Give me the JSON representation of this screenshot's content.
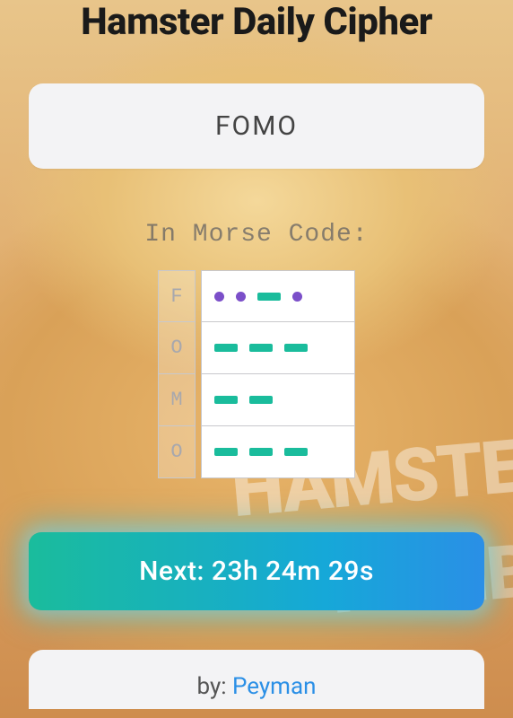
{
  "title": "Hamster Daily Cipher",
  "answer": "FOMO",
  "morse_label": "In Morse Code:",
  "morse_rows": [
    {
      "letter": "F",
      "pattern": [
        ".",
        ".",
        "-",
        "."
      ]
    },
    {
      "letter": "O",
      "pattern": [
        "-",
        "-",
        "-"
      ]
    },
    {
      "letter": "M",
      "pattern": [
        "-",
        "-"
      ]
    },
    {
      "letter": "O",
      "pattern": [
        "-",
        "-",
        "-"
      ]
    }
  ],
  "next_prefix": "Next: ",
  "next_time": "23h 24m 29s",
  "credit_prefix": "by: ",
  "credit_name": "Peyman",
  "bg_watermark_1": "HAMSTER",
  "bg_watermark_2": "KOMBAT"
}
